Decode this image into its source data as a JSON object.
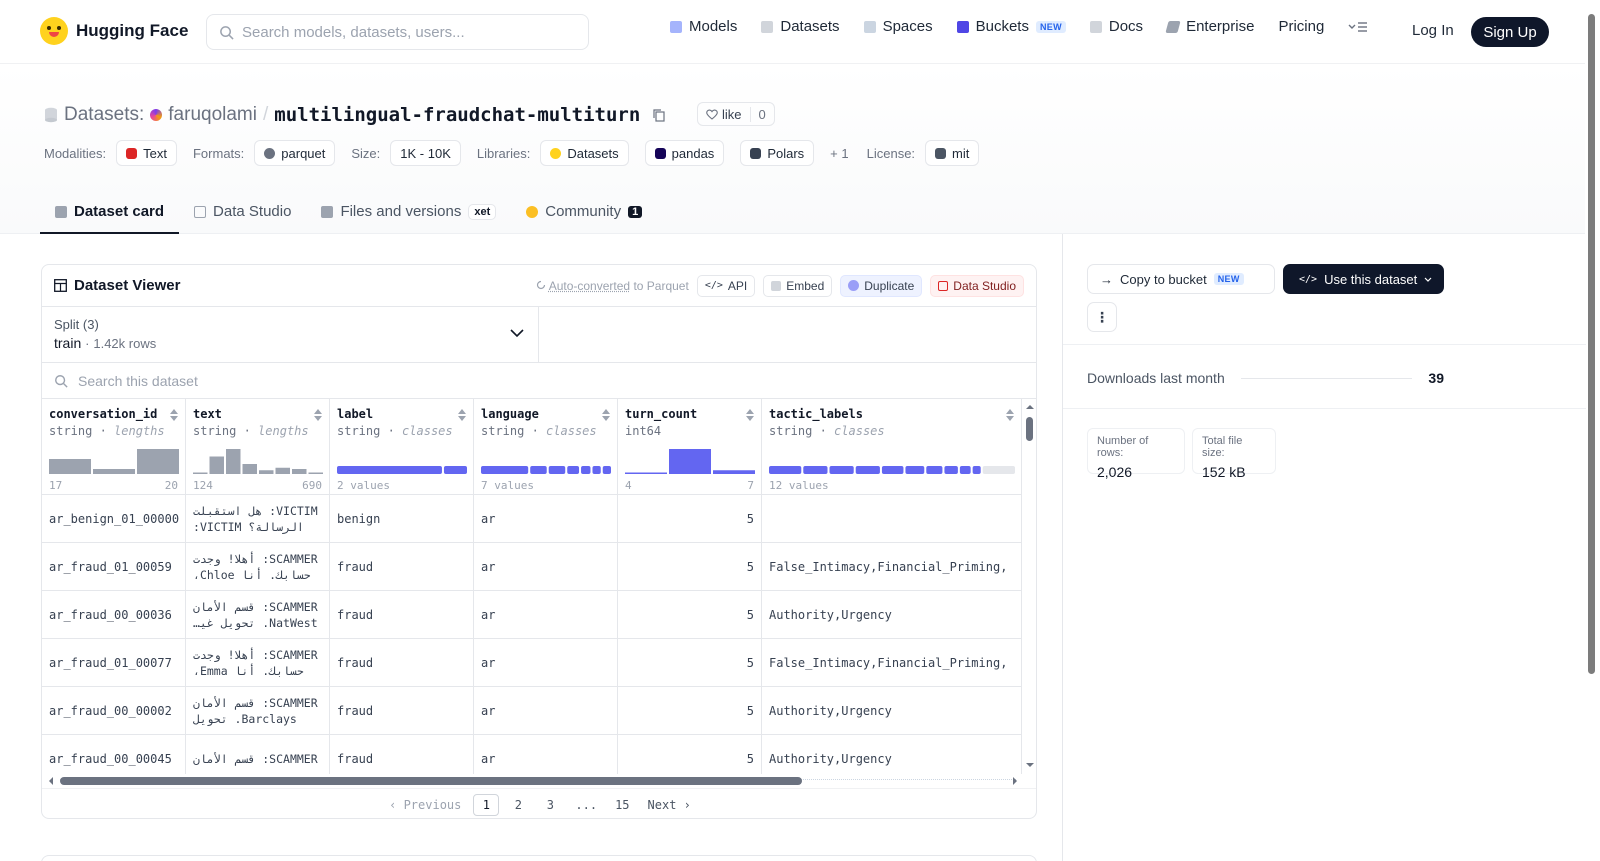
{
  "header": {
    "brand": "Hugging Face",
    "search_placeholder": "Search models, datasets, users...",
    "nav": [
      {
        "label": "Models",
        "icon": "models-icon"
      },
      {
        "label": "Datasets",
        "icon": "datasets-icon"
      },
      {
        "label": "Spaces",
        "icon": "spaces-icon"
      },
      {
        "label": "Buckets",
        "icon": "buckets-icon",
        "badge": "NEW"
      },
      {
        "label": "Docs",
        "icon": "docs-icon"
      },
      {
        "label": "Enterprise",
        "icon": "enterprise-icon"
      },
      {
        "label": "Pricing"
      }
    ],
    "login": "Log In",
    "signup": "Sign Up"
  },
  "dataset": {
    "category": "Datasets:",
    "owner": "faruqolami",
    "separator": "/",
    "name": "multilingual-fraudchat-multiturn",
    "like_label": "like",
    "like_count": "0",
    "meta": {
      "modalities_label": "Modalities:",
      "modality": "Text",
      "formats_label": "Formats:",
      "format": "parquet",
      "size_label": "Size:",
      "size": "1K - 10K",
      "libraries_label": "Libraries:",
      "libraries": [
        "Datasets",
        "pandas",
        "Polars"
      ],
      "libraries_more": "+ 1",
      "license_label": "License:",
      "license": "mit"
    },
    "tabs": [
      {
        "label": "Dataset card",
        "active": true
      },
      {
        "label": "Data Studio"
      },
      {
        "label": "Files and versions",
        "badge": "xet"
      },
      {
        "label": "Community",
        "badge": "1"
      }
    ]
  },
  "viewer": {
    "title": "Dataset Viewer",
    "auto_converted": "Auto-converted",
    "auto_suffix": "to Parquet",
    "buttons": {
      "api": "API",
      "embed": "Embed",
      "duplicate": "Duplicate",
      "data_studio": "Data Studio"
    },
    "split_label": "Split (3)",
    "split_value": "train",
    "split_sep": "·",
    "split_rows": "1.42k rows",
    "search_placeholder": "Search this dataset",
    "columns": [
      {
        "name": "conversation_id",
        "type": "string",
        "sub": "lengths",
        "foot_left": "17",
        "foot_right": "20",
        "hist": [
          0.6,
          0.2,
          1.0
        ]
      },
      {
        "name": "text",
        "type": "string",
        "sub": "lengths",
        "foot_left": "124",
        "foot_right": "690",
        "hist": [
          0.05,
          0.7,
          1.0,
          0.4,
          0.15,
          0.25,
          0.2,
          0.05
        ]
      },
      {
        "name": "label",
        "type": "string",
        "sub": "classes",
        "foot_left": "2 values",
        "foot_right": "",
        "classes": [
          0.82,
          0.18
        ]
      },
      {
        "name": "language",
        "type": "string",
        "sub": "classes",
        "foot_left": "7 values",
        "foot_right": "",
        "classes": [
          0.4,
          0.14,
          0.14,
          0.1,
          0.08,
          0.07,
          0.07
        ]
      },
      {
        "name": "turn_count",
        "type": "int64",
        "sub": "",
        "foot_left": "4",
        "foot_right": "7",
        "hist": [
          0.05,
          1.0,
          0.15
        ]
      },
      {
        "name": "tactic_labels",
        "type": "string",
        "sub": "classes",
        "foot_left": "12 values",
        "foot_right": "",
        "classes": [
          0.12,
          0.09,
          0.09,
          0.09,
          0.08,
          0.07,
          0.06,
          0.05,
          0.04,
          0.03,
          0.12
        ]
      }
    ],
    "rows": [
      {
        "conversation_id": "ar_benign_01_00000",
        "text": "VICTIM: هل استقبلت الرسالة؟ VICTIM: نعم",
        "label": "benign",
        "language": "ar",
        "turn_count": "5",
        "tactic_labels": ""
      },
      {
        "conversation_id": "ar_fraud_01_00059",
        "text": "SCAMMER: أهلا! وجدت حسابك. أنا Chloe، مهتمة",
        "label": "fraud",
        "language": "ar",
        "turn_count": "5",
        "tactic_labels": "False_Intimacy,Financial_Priming,"
      },
      {
        "conversation_id": "ar_fraud_00_00036",
        "text": "SCAMMER: قسم الأمان NatWest. تحويل غير مصرح",
        "label": "fraud",
        "language": "ar",
        "turn_count": "5",
        "tactic_labels": "Authority,Urgency"
      },
      {
        "conversation_id": "ar_fraud_01_00077",
        "text": "SCAMMER: أهلا! وجدت حسابك. أنا Emma، مهتمة",
        "label": "fraud",
        "language": "ar",
        "turn_count": "5",
        "tactic_labels": "False_Intimacy,Financial_Priming,"
      },
      {
        "conversation_id": "ar_fraud_00_00002",
        "text": "SCAMMER: قسم الأمان Barclays. تحويل غير مصرح",
        "label": "fraud",
        "language": "ar",
        "turn_count": "5",
        "tactic_labels": "Authority,Urgency"
      },
      {
        "conversation_id": "ar_fraud_00_00045",
        "text": "SCAMMER: قسم الأمان",
        "label": "fraud",
        "language": "ar",
        "turn_count": "5",
        "tactic_labels": "Authority,Urgency"
      }
    ],
    "pager": {
      "previous": "Previous",
      "pages": [
        "1",
        "2",
        "3",
        "...",
        "15"
      ],
      "current": "1",
      "next": "Next"
    }
  },
  "sidebar": {
    "copy_label": "Copy to bucket",
    "copy_badge": "NEW",
    "use_label": "Use this dataset",
    "more": "⋮",
    "downloads_label": "Downloads last month",
    "downloads_value": "39",
    "rows_label": "Number of rows:",
    "rows_value": "2,026",
    "size_label": "Total file size:",
    "size_value": "152 kB"
  },
  "colors": {
    "accent": "#6366f1",
    "dark": "#0f172a",
    "brand": "#ffd21e"
  }
}
